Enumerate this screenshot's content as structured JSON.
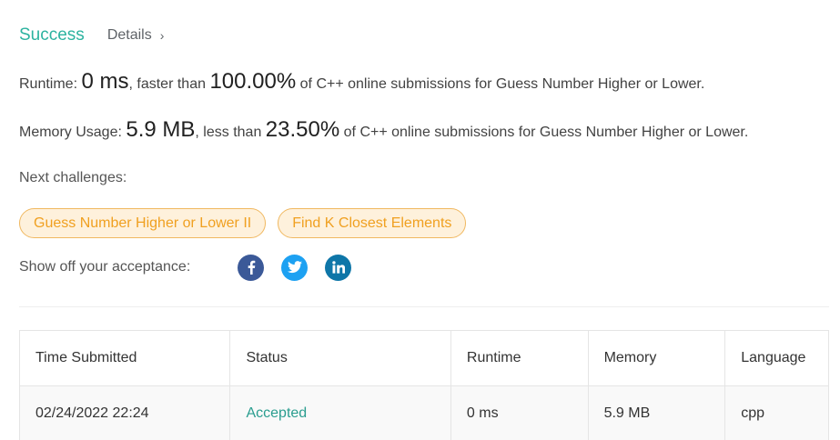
{
  "result": {
    "status": "Success",
    "details_label": "Details",
    "chevron": "›"
  },
  "runtime": {
    "label": "Runtime:",
    "value": "0 ms",
    "comparison": ", faster than",
    "percent": "100.00%",
    "suffix": "of C++ online submissions for Guess Number Higher or Lower."
  },
  "memory": {
    "label": "Memory Usage:",
    "value": "5.9 MB",
    "comparison": ", less than",
    "percent": "23.50%",
    "suffix": "of C++ online submissions for Guess Number Higher or Lower."
  },
  "next_challenges": {
    "title": "Next challenges:",
    "items": [
      {
        "label": "Guess Number Higher or Lower II"
      },
      {
        "label": "Find K Closest Elements"
      }
    ]
  },
  "share": {
    "label": "Show off your acceptance:",
    "icons": [
      "facebook-icon",
      "twitter-icon",
      "linkedin-icon"
    ],
    "colors": {
      "facebook": "#3b5998",
      "twitter": "#1da1f2",
      "linkedin": "#0e76a8"
    }
  },
  "submissions": {
    "columns": [
      "Time Submitted",
      "Status",
      "Runtime",
      "Memory",
      "Language"
    ],
    "rows": [
      {
        "time": "02/24/2022 22:24",
        "status": "Accepted",
        "runtime": "0 ms",
        "memory": "5.9 MB",
        "language": "cpp"
      }
    ]
  },
  "colors": {
    "success": "#2db3a0",
    "chip_text": "#f0a020",
    "chip_bg": "#fef1dc",
    "accepted": "#2a9d8f"
  }
}
